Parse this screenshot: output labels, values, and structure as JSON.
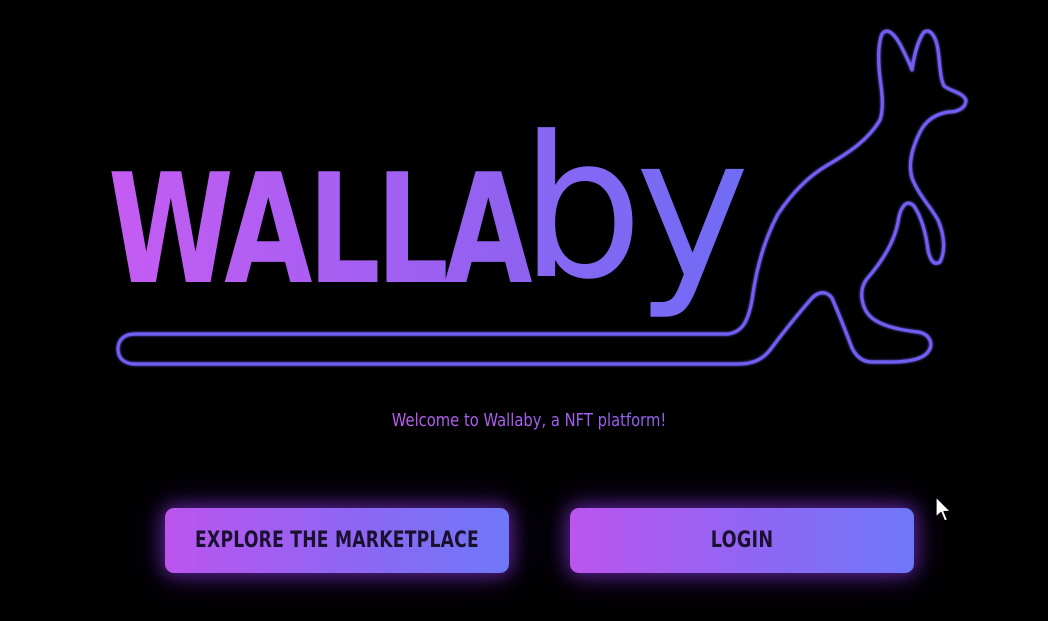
{
  "brand": {
    "name_caps": "WALLA",
    "name_lower": "by",
    "logo_icon": "kangaroo-icon",
    "gradient_start": "#c65cf3",
    "gradient_end": "#7c6cf5",
    "outline_color": "#6f5ff2"
  },
  "welcome": {
    "text": "Welcome to Wallaby, a NFT platform!"
  },
  "actions": {
    "explore_label": "EXPLORE THE MARKETPLACE",
    "login_label": "LOGIN"
  },
  "colors": {
    "background": "#000000",
    "button_gradient_start": "#bb55ee",
    "button_gradient_end": "#6e78f7",
    "button_text": "#1a1030"
  },
  "cursor": {
    "icon": "mouse-pointer-icon"
  }
}
